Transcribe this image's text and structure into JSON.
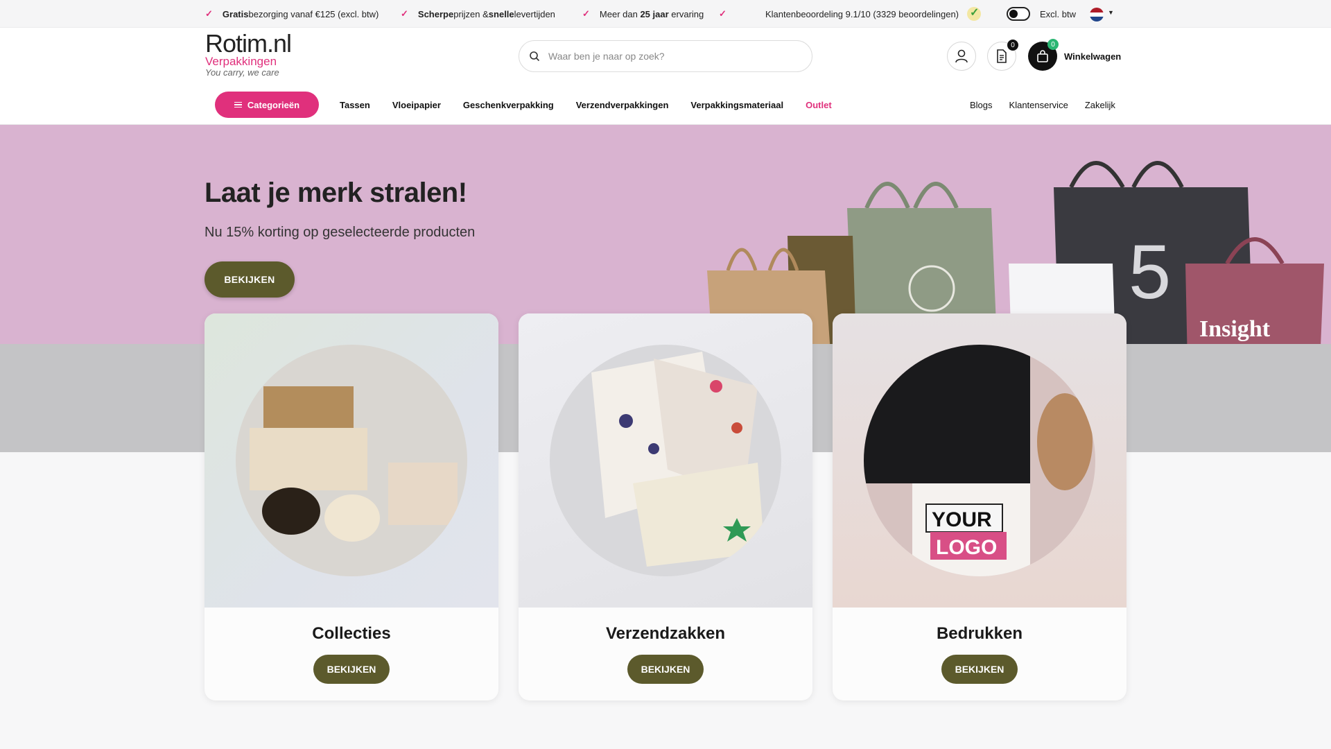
{
  "topbar": {
    "usps": [
      {
        "bold": "Gratis",
        "text": " bezorging vanaf €125 (excl. btw)"
      },
      {
        "bold": "Scherpe",
        "text": " prijzen & ",
        "bold2": "snelle",
        "text2": " levertijden"
      },
      {
        "text": "Meer dan ",
        "bold": "25 jaar",
        "text2": " ervaring"
      }
    ],
    "rating": "Klantenbeoordeling 9.1/10 (3329 beoordelingen)",
    "vat_toggle_label": "Excl. btw",
    "language": "NL"
  },
  "header": {
    "logo_main": "Rotim.nl",
    "logo_sub": "Verpakkingen",
    "logo_tagline": "You carry, we care",
    "search_placeholder": "Waar ben je naar op zoek?",
    "quote_count": "0",
    "cart_count": "0",
    "cart_label": "Winkelwagen"
  },
  "nav": {
    "categories_label": "Categorieën",
    "links": [
      "Tassen",
      "Vloeipapier",
      "Geschenkverpakking",
      "Verzendverpakkingen",
      "Verpakkingsmateriaal",
      "Outlet"
    ],
    "right_links": [
      "Blogs",
      "Klantenservice",
      "Zakelijk"
    ]
  },
  "hero": {
    "title": "Laat je merk stralen!",
    "subtitle": "Nu 15% korting op geselecteerde producten",
    "button": "BEKIJKEN"
  },
  "cards": [
    {
      "title": "Collecties",
      "button": "BEKIJKEN"
    },
    {
      "title": "Verzendzakken",
      "button": "BEKIJKEN"
    },
    {
      "title": "Bedrukken",
      "button": "BEKIJKEN"
    }
  ],
  "colors": {
    "brand_pink": "#e0307c",
    "olive_button": "#5c5a2c",
    "hero_bg": "#d9b3d0"
  }
}
